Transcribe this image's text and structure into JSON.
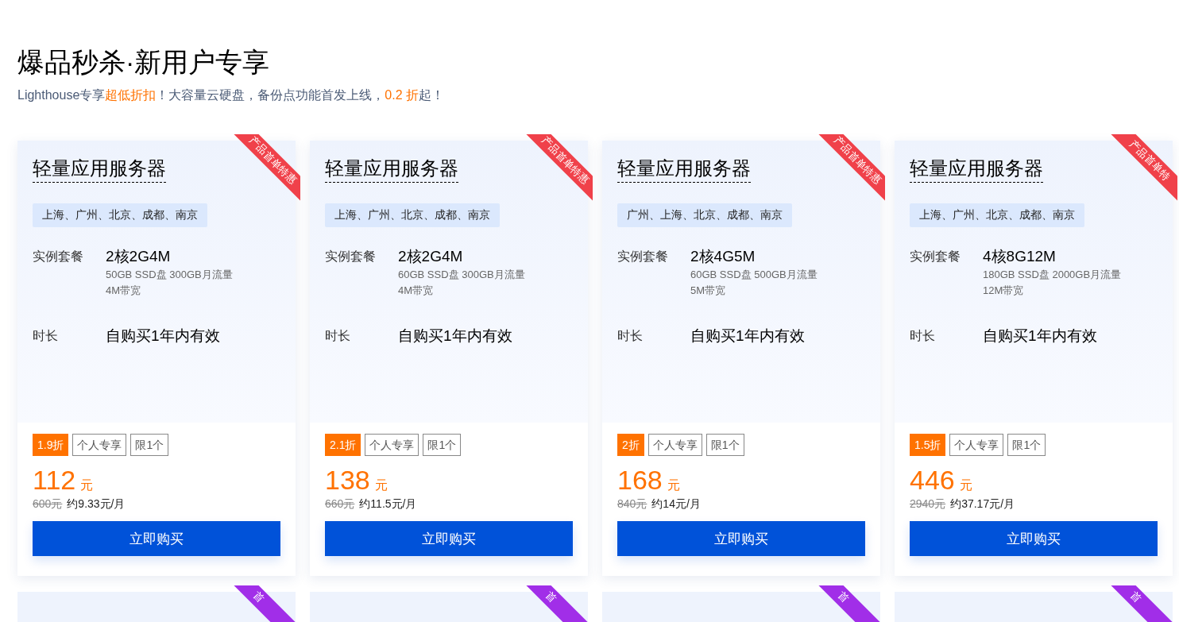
{
  "heading": "爆品秒杀·新用户专享",
  "subtitle": [
    {
      "text": "Lighthouse专享",
      "highlight": false
    },
    {
      "text": "超低折扣",
      "highlight": true
    },
    {
      "text": "！大容量云硬盘，备份点功能首发上线，",
      "highlight": false
    },
    {
      "text": "0.2 折",
      "highlight": true
    },
    {
      "text": "起！",
      "highlight": false
    }
  ],
  "cards": [
    {
      "ribbon": "产品首单特惠",
      "title": "轻量应用服务器",
      "regions": "上海、广州、北京、成都、南京",
      "spec_label": "实例套餐",
      "spec": "2核2G4M",
      "spec_detail": [
        "50GB SSD盘 300GB月流量",
        "4M带宽"
      ],
      "duration_label": "时长",
      "duration": "自购买1年内有效",
      "tags": [
        {
          "text": "1.9折",
          "kind": "discount"
        },
        {
          "text": "个人专享",
          "kind": "outline"
        },
        {
          "text": "限1个",
          "kind": "outline"
        }
      ],
      "price": "112",
      "unit": "元",
      "original": "600元",
      "monthly": "约9.33元/月",
      "button": "立即购买"
    },
    {
      "ribbon": "产品首单特惠",
      "title": "轻量应用服务器",
      "regions": "上海、广州、北京、成都、南京",
      "spec_label": "实例套餐",
      "spec": "2核2G4M",
      "spec_detail": [
        "60GB SSD盘 300GB月流量",
        "4M带宽"
      ],
      "duration_label": "时长",
      "duration": "自购买1年内有效",
      "tags": [
        {
          "text": "2.1折",
          "kind": "discount"
        },
        {
          "text": "个人专享",
          "kind": "outline"
        },
        {
          "text": "限1个",
          "kind": "outline"
        }
      ],
      "price": "138",
      "unit": "元",
      "original": "660元",
      "monthly": "约11.5元/月",
      "button": "立即购买"
    },
    {
      "ribbon": "产品首单特惠",
      "title": "轻量应用服务器",
      "regions": "广州、上海、北京、成都、南京",
      "spec_label": "实例套餐",
      "spec": "2核4G5M",
      "spec_detail": [
        "60GB SSD盘 500GB月流量",
        "5M带宽"
      ],
      "duration_label": "时长",
      "duration": "自购买1年内有效",
      "tags": [
        {
          "text": "2折",
          "kind": "discount"
        },
        {
          "text": "个人专享",
          "kind": "outline"
        },
        {
          "text": "限1个",
          "kind": "outline"
        }
      ],
      "price": "168",
      "unit": "元",
      "original": "840元",
      "monthly": "约14元/月",
      "button": "立即购买"
    },
    {
      "ribbon": "产品首单特",
      "title": "轻量应用服务器",
      "regions": "上海、广州、北京、成都、南京",
      "spec_label": "实例套餐",
      "spec": "4核8G12M",
      "spec_detail": [
        "180GB SSD盘 2000GB月流量",
        "12M带宽"
      ],
      "duration_label": "时长",
      "duration": "自购买1年内有效",
      "tags": [
        {
          "text": "1.5折",
          "kind": "discount"
        },
        {
          "text": "个人专享",
          "kind": "outline"
        },
        {
          "text": "限1个",
          "kind": "outline"
        }
      ],
      "price": "446",
      "unit": "元",
      "original": "2940元",
      "monthly": "约37.17元/月",
      "button": "立即购买"
    }
  ],
  "next_cards": [
    {
      "ribbon": "首"
    },
    {
      "ribbon": "首"
    },
    {
      "ribbon": "首"
    },
    {
      "ribbon": "首"
    }
  ]
}
